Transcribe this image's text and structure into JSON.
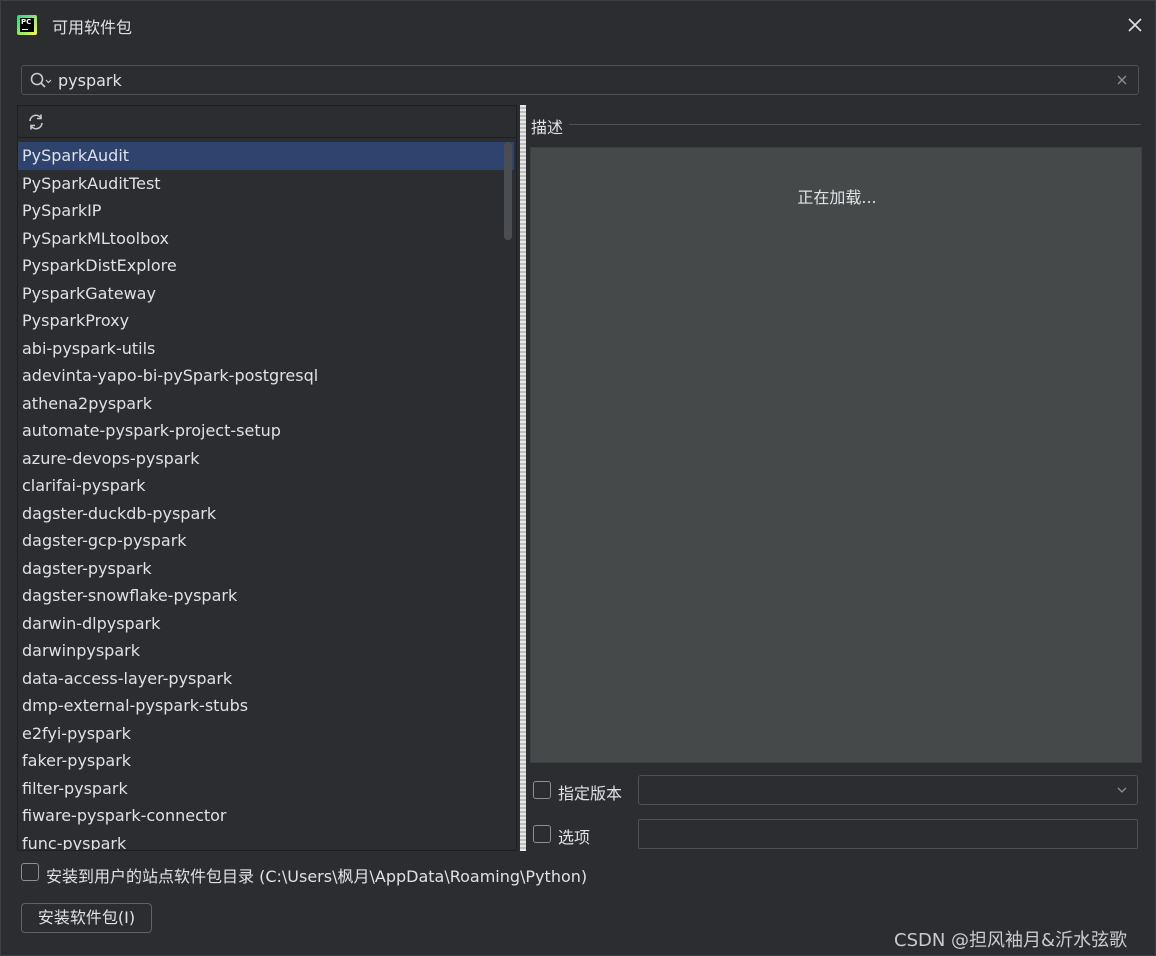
{
  "window": {
    "title": "可用软件包",
    "close_glyph": "✕"
  },
  "search": {
    "value": "pyspark",
    "placeholder": "",
    "clear_glyph": "✕"
  },
  "packages": {
    "selected_index": 0,
    "items": [
      "PySparkAudit",
      "PySparkAuditTest",
      "PySparkIP",
      "PySparkMLtoolbox",
      "PysparkDistExplore",
      "PysparkGateway",
      "PysparkProxy",
      "abi-pyspark-utils",
      "adevinta-yapo-bi-pySpark-postgresql",
      "athena2pyspark",
      "automate-pyspark-project-setup",
      "azure-devops-pyspark",
      "clarifai-pyspark",
      "dagster-duckdb-pyspark",
      "dagster-gcp-pyspark",
      "dagster-pyspark",
      "dagster-snowflake-pyspark",
      "darwin-dlpyspark",
      "darwinpyspark",
      "data-access-layer-pyspark",
      "dmp-external-pyspark-stubs",
      "e2fyi-pyspark",
      "faker-pyspark",
      "filter-pyspark",
      "fiware-pyspark-connector",
      "func-pyspark"
    ]
  },
  "description": {
    "title": "描述",
    "loading_text": "正在加载..."
  },
  "options": {
    "specify_version_label": "指定版本",
    "specify_version_checked": false,
    "version_value": "",
    "options_label": "选项",
    "options_checked": false,
    "options_value": "",
    "install_user_site_label": "安装到用户的站点软件包目录 (C:\\Users\\枫月\\AppData\\Roaming\\Python)",
    "install_user_site_checked": false
  },
  "actions": {
    "install_button_label": "安装软件包(I)"
  },
  "watermark": "CSDN @担风袖月&沂水弦歌",
  "colors": {
    "background": "#2b2d30",
    "selection": "#2e436e",
    "description_bg": "#45494a",
    "border": "#4e5157"
  }
}
